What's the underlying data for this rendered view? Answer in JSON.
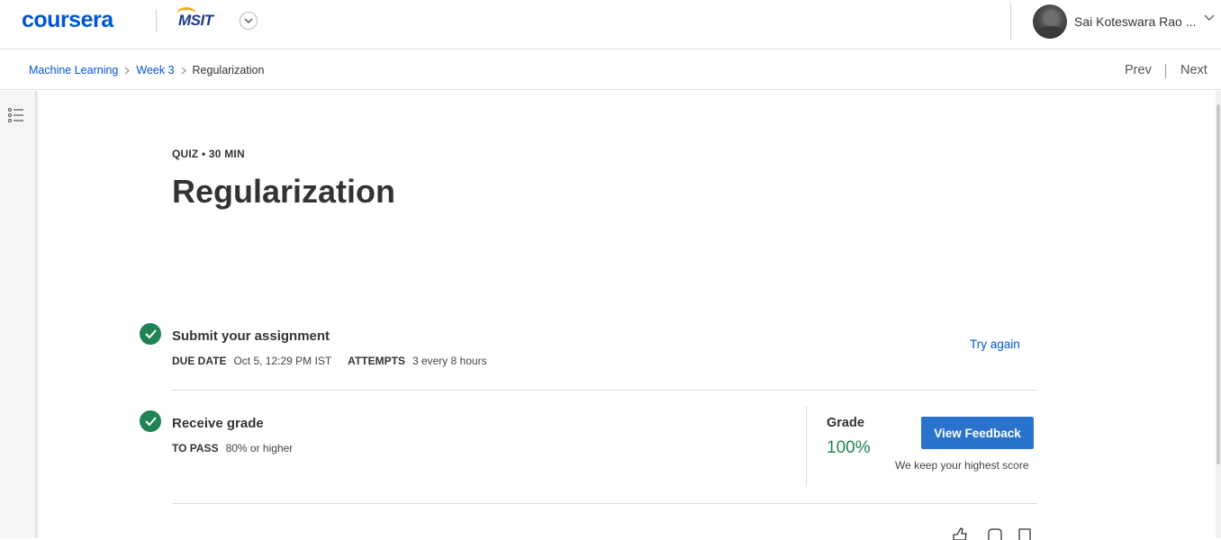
{
  "header": {
    "brand": "coursera",
    "partner_logo_text": "MSIT",
    "user_name": "Sai Koteswara Rao ..."
  },
  "breadcrumb": {
    "items": [
      "Machine Learning",
      "Week 3"
    ],
    "current": "Regularization"
  },
  "nav": {
    "prev": "Prev",
    "next": "Next"
  },
  "quiz": {
    "eyebrow": "QUIZ • 30 MIN",
    "title": "Regularization"
  },
  "submit_step": {
    "title": "Submit your assignment",
    "due_label": "DUE DATE",
    "due_value": "Oct 5, 12:29 PM IST",
    "attempts_label": "ATTEMPTS",
    "attempts_value": "3 every 8 hours",
    "action": "Try again"
  },
  "grade_step": {
    "title": "Receive grade",
    "pass_label": "TO PASS",
    "pass_value": "80% or higher",
    "grade_label": "Grade",
    "grade_value": "100%",
    "button": "View Feedback",
    "note": "We keep your highest score"
  },
  "colors": {
    "brand": "#0056d2",
    "success": "#1f8354",
    "button": "#2a73cc"
  },
  "icons": [
    "chevron-down-icon",
    "chevron-right-icon",
    "outline-list-icon",
    "check-icon",
    "like-icon",
    "comment-icon",
    "bookmark-icon"
  ]
}
